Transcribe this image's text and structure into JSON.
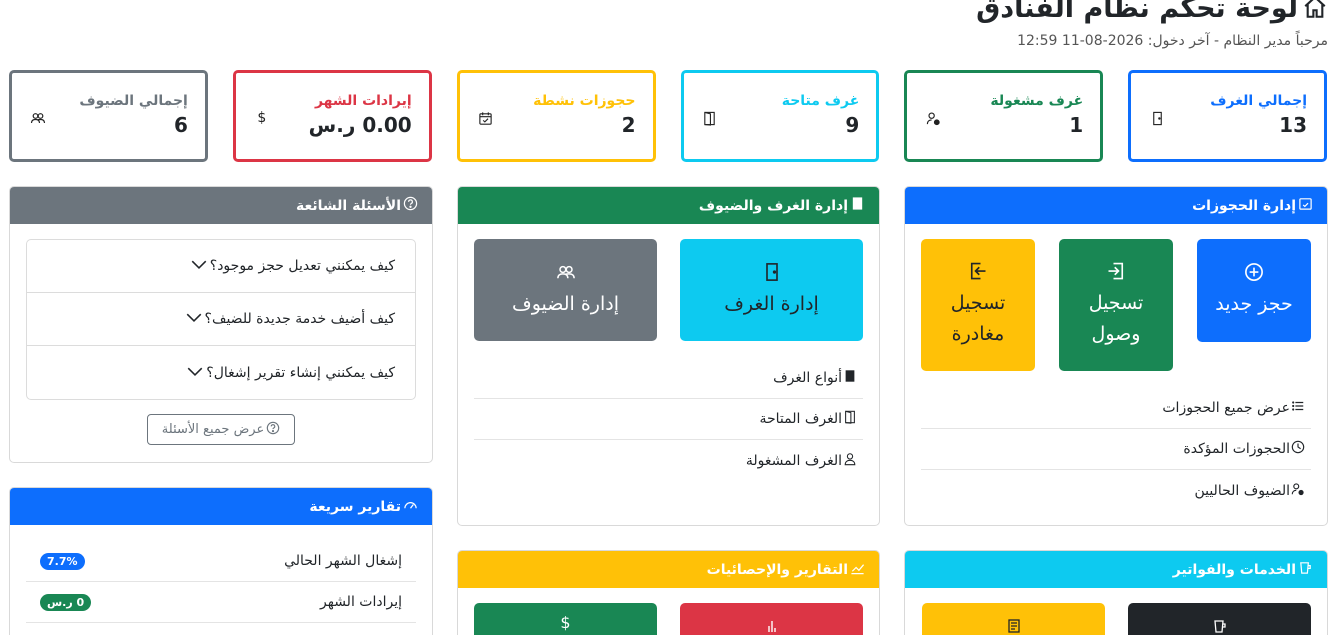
{
  "header": {
    "title": "لوحة تحكم نظام الفنادق",
    "subtitle": "مرحباً مدير النظام - آخر دخول: 2026-08-11 12:59"
  },
  "stats": [
    {
      "label": "إجمالي الغرف",
      "value": "13",
      "color": "#0d6efd",
      "icon": "door-closed-icon"
    },
    {
      "label": "غرف مشغولة",
      "value": "1",
      "color": "#198754",
      "icon": "person-fill-icon"
    },
    {
      "label": "غرف متاحة",
      "value": "9",
      "color": "#0dcaf0",
      "icon": "door-open-icon"
    },
    {
      "label": "حجوزات نشطة",
      "value": "2",
      "color": "#ffc107",
      "icon": "calendar-check-icon"
    },
    {
      "label": "إيرادات الشهر",
      "value": "0.00 ر.س",
      "color": "#dc3545",
      "icon": "dollar-icon",
      "icon_text": "$"
    },
    {
      "label": "إجمالي الضيوف",
      "value": "6",
      "color": "#6c757d",
      "icon": "people-icon"
    }
  ],
  "bookings": {
    "title": "إدارة الحجوزات",
    "header_color": "#0d6efd",
    "tiles": [
      {
        "label": "حجز جديد",
        "color": "#0d6efd",
        "icon": "plus-circle-icon"
      },
      {
        "label": "تسجيل وصول",
        "color": "#198754",
        "icon": "box-arrow-in-icon"
      },
      {
        "label": "تسجيل مغادرة",
        "color": "#ffc107",
        "icon": "box-arrow-out-icon"
      }
    ],
    "links": [
      {
        "label": "عرض جميع الحجوزات",
        "icon": "list-icon"
      },
      {
        "label": "الحجوزات المؤكدة",
        "icon": "clock-icon"
      },
      {
        "label": "الضيوف الحاليين",
        "icon": "person-check-icon"
      }
    ]
  },
  "rooms": {
    "title": "إدارة الغرف والضيوف",
    "header_color": "#198754",
    "tiles": [
      {
        "label": "إدارة الغرف",
        "color": "#0dcaf0",
        "icon": "door-closed-icon"
      },
      {
        "label": "إدارة الضيوف",
        "color": "#6c757d",
        "icon": "people-icon"
      }
    ],
    "links": [
      {
        "label": "أنواع الغرف",
        "icon": "building-icon"
      },
      {
        "label": "الغرف المتاحة",
        "icon": "door-open-icon"
      },
      {
        "label": "الغرف المشغولة",
        "icon": "person-icon"
      }
    ]
  },
  "faq": {
    "title": "الأسئلة الشائعة",
    "header_color": "#6c757d",
    "items": [
      "كيف يمكنني تعديل حجز موجود؟",
      "كيف أضيف خدمة جديدة للضيف؟",
      "كيف يمكنني إنشاء تقرير إشغال؟"
    ],
    "button": "عرض جميع الأسئلة"
  },
  "quick_reports": {
    "title": "تقارير سريعة",
    "header_color": "#0d6efd",
    "rows": [
      {
        "label": "إشغال الشهر الحالي",
        "badge": "7.7%",
        "color": "#0d6efd"
      },
      {
        "label": "إيرادات الشهر",
        "badge": "0 ر.س",
        "color": "#198754"
      }
    ]
  },
  "reports": {
    "title": "التقارير والإحصائيات",
    "header_color": "#ffc107",
    "tiles": [
      {
        "color": "#dc3545"
      },
      {
        "color": "#198754",
        "icon_text": "$"
      }
    ]
  },
  "services": {
    "title": "الخدمات والفواتير",
    "header_color": "#0dcaf0",
    "tiles": [
      {
        "color": "#212529"
      },
      {
        "color": "#ffc107"
      }
    ]
  }
}
